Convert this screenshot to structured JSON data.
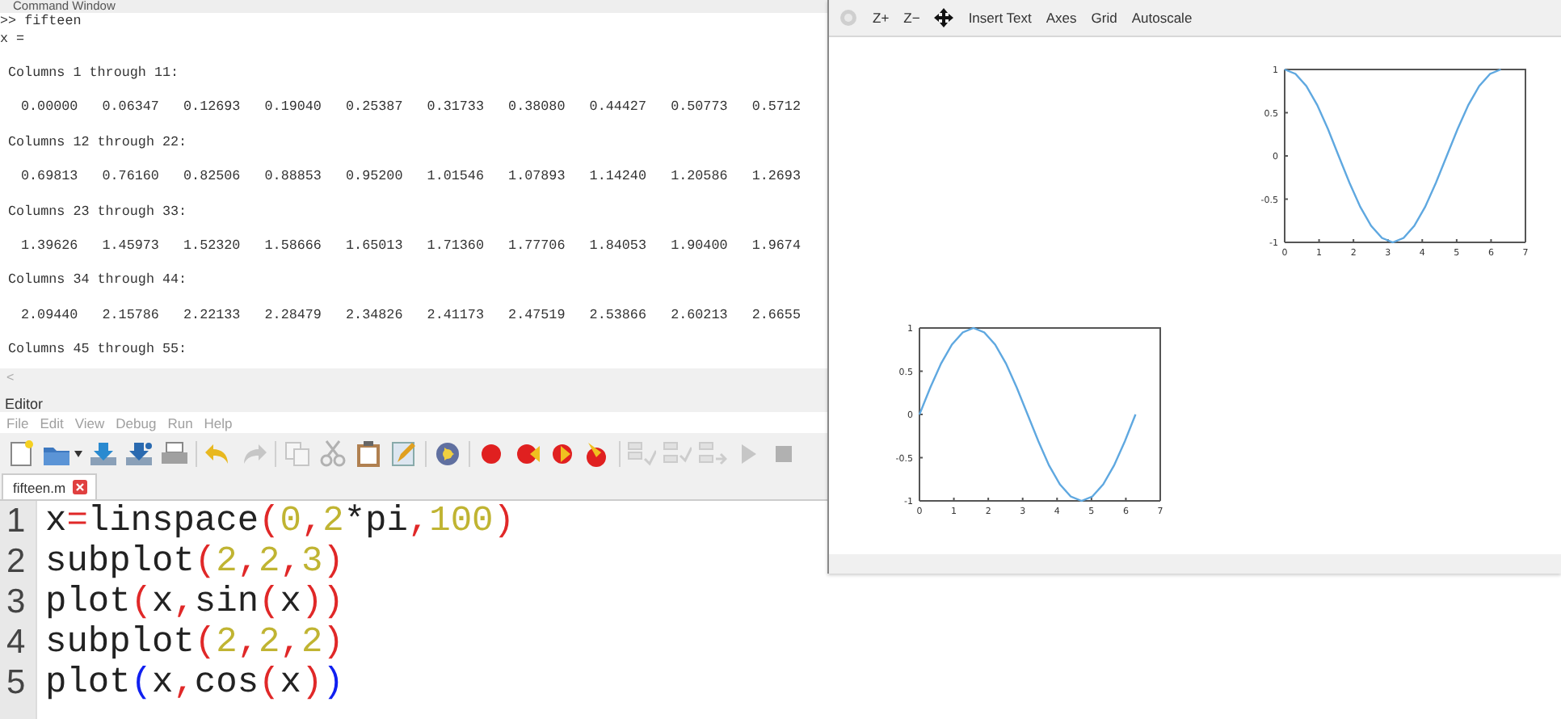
{
  "command_window": {
    "title": "Command Window",
    "prompt": ">> fifteen",
    "result": "x =",
    "scroll_glyph": "<",
    "blocks": [
      {
        "header": "Columns 1 through 11:",
        "values": "0.00000   0.06347   0.12693   0.19040   0.25387   0.31733   0.38080   0.44427   0.50773   0.5712"
      },
      {
        "header": "Columns 12 through 22:",
        "values": "0.69813   0.76160   0.82506   0.88853   0.95200   1.01546   1.07893   1.14240   1.20586   1.2693"
      },
      {
        "header": "Columns 23 through 33:",
        "values": "1.39626   1.45973   1.52320   1.58666   1.65013   1.71360   1.77706   1.84053   1.90400   1.9674"
      },
      {
        "header": "Columns 34 through 44:",
        "values": "2.09440   2.15786   2.22133   2.28479   2.34826   2.41173   2.47519   2.53866   2.60213   2.6655"
      },
      {
        "header": "Columns 45 through 55:"
      }
    ]
  },
  "editor": {
    "title": "Editor",
    "menu": [
      "File",
      "Edit",
      "View",
      "Debug",
      "Run",
      "Help"
    ],
    "toolbar": [
      {
        "disabled": false
      },
      {
        "disabled": false
      },
      {
        "disabled": false
      },
      {
        "disabled": false
      },
      {
        "disabled": false
      },
      {
        "disabled": false
      },
      {
        "disabled": true
      },
      {
        "disabled": true
      },
      {
        "disabled": true
      },
      {
        "disabled": false
      },
      {
        "disabled": false
      },
      {
        "disabled": false
      },
      {
        "disabled": false
      },
      {
        "disabled": false
      },
      {
        "disabled": false
      },
      {
        "disabled": false
      },
      {
        "disabled": true
      },
      {
        "disabled": true
      },
      {
        "disabled": true
      },
      {
        "disabled": true
      },
      {
        "disabled": true
      }
    ],
    "tabs": [
      {
        "label": "fifteen.m",
        "selected": true
      }
    ],
    "code": [
      {
        "number": "1",
        "tokens": [
          {
            "kind": "ident",
            "text": "x"
          },
          {
            "kind": "op",
            "text": "="
          },
          {
            "kind": "ident",
            "text": "linspace"
          },
          {
            "kind": "op",
            "text": "("
          },
          {
            "kind": "num",
            "text": "0"
          },
          {
            "kind": "op",
            "text": ","
          },
          {
            "kind": "num",
            "text": "2"
          },
          {
            "kind": "ident",
            "text": "*pi"
          },
          {
            "kind": "op",
            "text": ","
          },
          {
            "kind": "num",
            "text": "100"
          },
          {
            "kind": "op",
            "text": ")"
          }
        ]
      },
      {
        "number": "2",
        "tokens": [
          {
            "kind": "ident",
            "text": "subplot"
          },
          {
            "kind": "op",
            "text": "("
          },
          {
            "kind": "num",
            "text": "2"
          },
          {
            "kind": "op",
            "text": ","
          },
          {
            "kind": "num",
            "text": "2"
          },
          {
            "kind": "op",
            "text": ","
          },
          {
            "kind": "num",
            "text": "3"
          },
          {
            "kind": "op",
            "text": ")"
          }
        ]
      },
      {
        "number": "3",
        "tokens": [
          {
            "kind": "ident",
            "text": "plot"
          },
          {
            "kind": "op",
            "text": "("
          },
          {
            "kind": "ident",
            "text": "x"
          },
          {
            "kind": "op",
            "text": ","
          },
          {
            "kind": "ident",
            "text": "sin"
          },
          {
            "kind": "op",
            "text": "("
          },
          {
            "kind": "ident",
            "text": "x"
          },
          {
            "kind": "op",
            "text": "))"
          }
        ]
      },
      {
        "number": "4",
        "tokens": [
          {
            "kind": "ident",
            "text": "subplot"
          },
          {
            "kind": "op",
            "text": "("
          },
          {
            "kind": "num",
            "text": "2"
          },
          {
            "kind": "op",
            "text": ","
          },
          {
            "kind": "num",
            "text": "2"
          },
          {
            "kind": "op",
            "text": ","
          },
          {
            "kind": "num",
            "text": "2"
          },
          {
            "kind": "op",
            "text": ")"
          }
        ]
      },
      {
        "number": "5",
        "tokens": [
          {
            "kind": "ident",
            "text": "plot"
          },
          {
            "kind": "match",
            "text": "("
          },
          {
            "kind": "ident",
            "text": "x"
          },
          {
            "kind": "op",
            "text": ","
          },
          {
            "kind": "ident",
            "text": "cos"
          },
          {
            "kind": "op",
            "text": "("
          },
          {
            "kind": "ident",
            "text": "x"
          },
          {
            "kind": "op",
            "text": ")"
          },
          {
            "kind": "match",
            "text": ")"
          }
        ]
      }
    ]
  },
  "figure": {
    "toolbar": [
      {
        "kind": "icon",
        "disabled": true
      },
      {
        "kind": "text",
        "label": "Z+"
      },
      {
        "kind": "text",
        "label": "Z−"
      },
      {
        "kind": "icon",
        "disabled": false
      },
      {
        "kind": "text",
        "label": "Insert Text"
      },
      {
        "kind": "text",
        "label": "Axes"
      },
      {
        "kind": "text",
        "label": "Grid"
      },
      {
        "kind": "text",
        "label": "Autoscale"
      }
    ],
    "subplots": [
      {
        "chart_data": {
          "type": "line",
          "x": [
            0,
            0.314,
            0.628,
            0.942,
            1.257,
            1.571,
            1.885,
            2.199,
            2.513,
            2.827,
            3.142,
            3.456,
            3.77,
            4.084,
            4.398,
            4.712,
            5.027,
            5.341,
            5.655,
            5.969,
            6.283
          ],
          "series": [
            {
              "color": "#5fa8e0",
              "values": [
                1,
                0.95,
                0.81,
                0.59,
                0.31,
                0,
                -0.31,
                -0.59,
                -0.81,
                -0.95,
                -1,
                -0.95,
                -0.81,
                -0.59,
                -0.31,
                0,
                0.31,
                0.59,
                0.81,
                0.95,
                1
              ]
            }
          ],
          "xlim": [
            0,
            7
          ],
          "ylim": [
            -1,
            1
          ],
          "xticks": [
            0,
            1,
            2,
            3,
            4,
            5,
            6,
            7
          ],
          "yticks": [
            -1,
            -0.5,
            0,
            0.5,
            1
          ]
        }
      },
      {
        "chart_data": {
          "type": "line",
          "x": [
            0,
            0.314,
            0.628,
            0.942,
            1.257,
            1.571,
            1.885,
            2.199,
            2.513,
            2.827,
            3.142,
            3.456,
            3.77,
            4.084,
            4.398,
            4.712,
            5.027,
            5.341,
            5.655,
            5.969,
            6.283
          ],
          "series": [
            {
              "color": "#5fa8e0",
              "values": [
                0,
                0.31,
                0.59,
                0.81,
                0.95,
                1,
                0.95,
                0.81,
                0.59,
                0.31,
                0,
                -0.31,
                -0.59,
                -0.81,
                -0.95,
                -1,
                -0.95,
                -0.81,
                -0.59,
                -0.31,
                0
              ]
            }
          ],
          "xlim": [
            0,
            7
          ],
          "ylim": [
            -1,
            1
          ],
          "xticks": [
            0,
            1,
            2,
            3,
            4,
            5,
            6,
            7
          ],
          "yticks": [
            -1,
            -0.5,
            0,
            0.5,
            1
          ]
        }
      }
    ]
  }
}
